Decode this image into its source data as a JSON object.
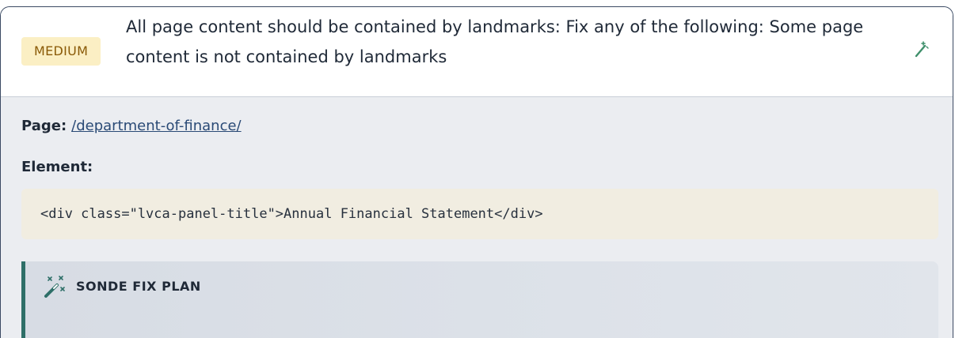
{
  "issue": {
    "severity": "MEDIUM",
    "title": "All page content should be contained by landmarks: Fix any of the following: Some page content is not contained by landmarks",
    "fix_action_icon": "magic-wand-icon"
  },
  "details": {
    "page_label": "Page:",
    "page_link": "/department-of-finance/",
    "element_label": "Element:",
    "element_code": "<div class=\"lvca-panel-title\">Annual Financial Statement</div>"
  },
  "fix_plan": {
    "icon": "sparkle-wand-icon",
    "title": "SONDE FIX PLAN"
  },
  "colors": {
    "badge_bg": "#fbefc4",
    "badge_text": "#8a5a07",
    "accent": "#2e6f68",
    "link": "#2a4a76",
    "code_bg": "#f1ede1"
  }
}
